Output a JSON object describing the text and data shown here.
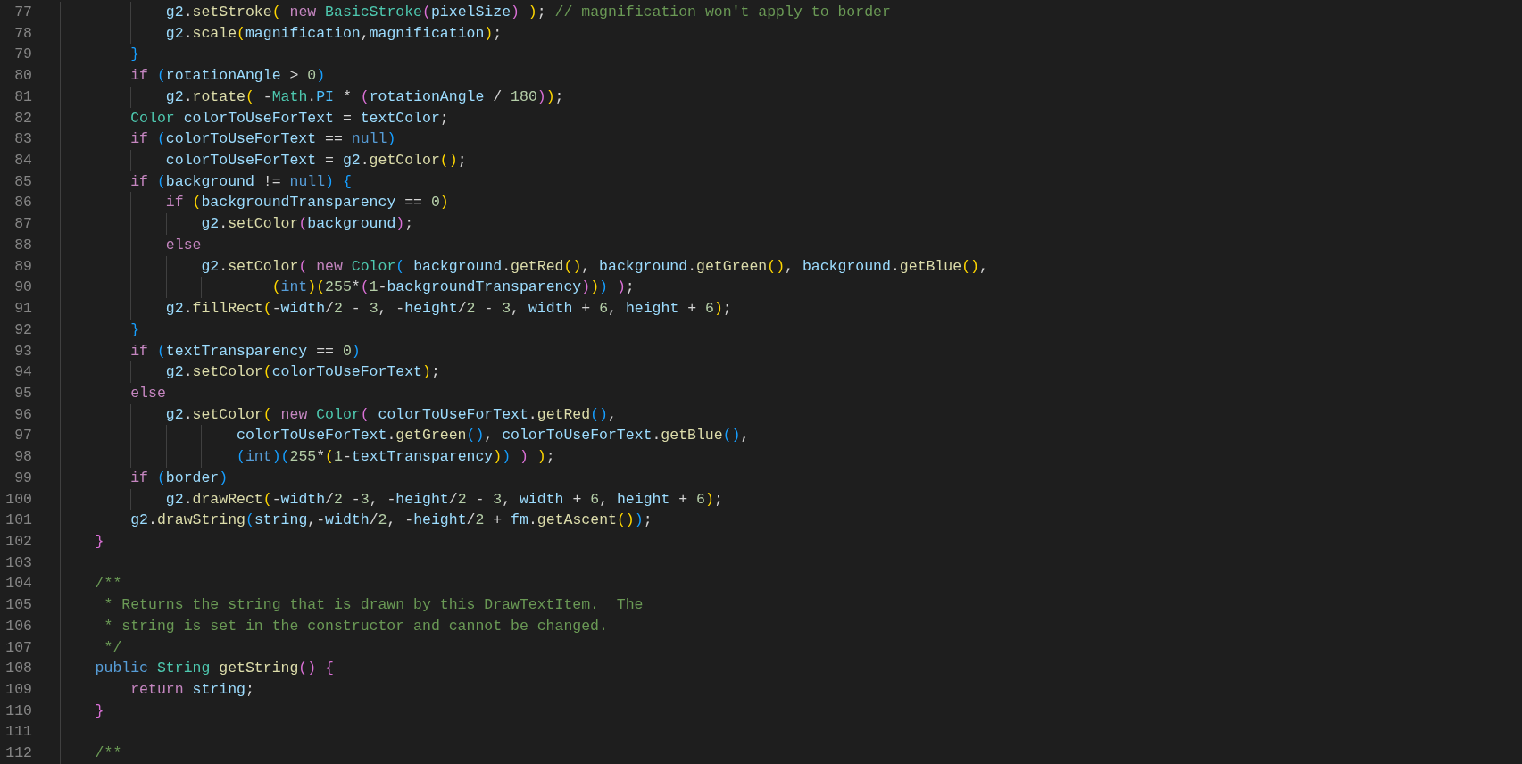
{
  "editor": {
    "lines": [
      {
        "number": "77",
        "tokens": [
          {
            "kind": "id",
            "text": "            g2"
          },
          {
            "kind": "p",
            "text": "."
          },
          {
            "kind": "fn",
            "text": "setStroke"
          },
          {
            "kind": "b1",
            "text": "( "
          },
          {
            "kind": "kw",
            "text": "new "
          },
          {
            "kind": "ty",
            "text": "BasicStroke"
          },
          {
            "kind": "b2",
            "text": "("
          },
          {
            "kind": "id",
            "text": "pixelSize"
          },
          {
            "kind": "b2",
            "text": ") "
          },
          {
            "kind": "b1",
            "text": ")"
          },
          {
            "kind": "p",
            "text": "; "
          },
          {
            "kind": "cm",
            "text": "// magnification won't apply to border"
          }
        ]
      },
      {
        "number": "78",
        "tokens": [
          {
            "kind": "id",
            "text": "            g2"
          },
          {
            "kind": "p",
            "text": "."
          },
          {
            "kind": "fn",
            "text": "scale"
          },
          {
            "kind": "b1",
            "text": "("
          },
          {
            "kind": "id",
            "text": "magnification"
          },
          {
            "kind": "p",
            "text": ","
          },
          {
            "kind": "id",
            "text": "magnification"
          },
          {
            "kind": "b1",
            "text": ")"
          },
          {
            "kind": "p",
            "text": ";"
          }
        ]
      },
      {
        "number": "79",
        "tokens": [
          {
            "kind": "b3",
            "text": "        }"
          }
        ]
      },
      {
        "number": "80",
        "tokens": [
          {
            "kind": "kw",
            "text": "        if "
          },
          {
            "kind": "b3",
            "text": "("
          },
          {
            "kind": "id",
            "text": "rotationAngle "
          },
          {
            "kind": "p",
            "text": "> "
          },
          {
            "kind": "num",
            "text": "0"
          },
          {
            "kind": "b3",
            "text": ")"
          }
        ]
      },
      {
        "number": "81",
        "tokens": [
          {
            "kind": "id",
            "text": "            g2"
          },
          {
            "kind": "p",
            "text": "."
          },
          {
            "kind": "fn",
            "text": "rotate"
          },
          {
            "kind": "b1",
            "text": "("
          },
          {
            "kind": "p",
            "text": " -"
          },
          {
            "kind": "ty",
            "text": "Math"
          },
          {
            "kind": "p",
            "text": "."
          },
          {
            "kind": "cn",
            "text": "PI"
          },
          {
            "kind": "p",
            "text": " * "
          },
          {
            "kind": "b2",
            "text": "("
          },
          {
            "kind": "id",
            "text": "rotationAngle "
          },
          {
            "kind": "p",
            "text": "/ "
          },
          {
            "kind": "num",
            "text": "180"
          },
          {
            "kind": "b2",
            "text": ")"
          },
          {
            "kind": "b1",
            "text": ")"
          },
          {
            "kind": "p",
            "text": ";"
          }
        ]
      },
      {
        "number": "82",
        "tokens": [
          {
            "kind": "ty",
            "text": "        Color "
          },
          {
            "kind": "id",
            "text": "colorToUseForText "
          },
          {
            "kind": "p",
            "text": "= "
          },
          {
            "kind": "id",
            "text": "textColor"
          },
          {
            "kind": "p",
            "text": ";"
          }
        ]
      },
      {
        "number": "83",
        "tokens": [
          {
            "kind": "kw",
            "text": "        if "
          },
          {
            "kind": "b3",
            "text": "("
          },
          {
            "kind": "id",
            "text": "colorToUseForText "
          },
          {
            "kind": "p",
            "text": "== "
          },
          {
            "kind": "st",
            "text": "null"
          },
          {
            "kind": "b3",
            "text": ")"
          }
        ]
      },
      {
        "number": "84",
        "tokens": [
          {
            "kind": "id",
            "text": "            colorToUseForText "
          },
          {
            "kind": "p",
            "text": "= "
          },
          {
            "kind": "id",
            "text": "g2"
          },
          {
            "kind": "p",
            "text": "."
          },
          {
            "kind": "fn",
            "text": "getColor"
          },
          {
            "kind": "b1",
            "text": "()"
          },
          {
            "kind": "p",
            "text": ";"
          }
        ]
      },
      {
        "number": "85",
        "tokens": [
          {
            "kind": "kw",
            "text": "        if "
          },
          {
            "kind": "b3",
            "text": "("
          },
          {
            "kind": "id",
            "text": "background "
          },
          {
            "kind": "p",
            "text": "!= "
          },
          {
            "kind": "st",
            "text": "null"
          },
          {
            "kind": "b3",
            "text": ") {"
          }
        ]
      },
      {
        "number": "86",
        "tokens": [
          {
            "kind": "kw",
            "text": "            if "
          },
          {
            "kind": "b1",
            "text": "("
          },
          {
            "kind": "id",
            "text": "backgroundTransparency "
          },
          {
            "kind": "p",
            "text": "== "
          },
          {
            "kind": "num",
            "text": "0"
          },
          {
            "kind": "b1",
            "text": ")"
          }
        ]
      },
      {
        "number": "87",
        "tokens": [
          {
            "kind": "id",
            "text": "                g2"
          },
          {
            "kind": "p",
            "text": "."
          },
          {
            "kind": "fn",
            "text": "setColor"
          },
          {
            "kind": "b2",
            "text": "("
          },
          {
            "kind": "id",
            "text": "background"
          },
          {
            "kind": "b2",
            "text": ")"
          },
          {
            "kind": "p",
            "text": ";"
          }
        ]
      },
      {
        "number": "88",
        "tokens": [
          {
            "kind": "kw",
            "text": "            else"
          }
        ]
      },
      {
        "number": "89",
        "tokens": [
          {
            "kind": "id",
            "text": "                g2"
          },
          {
            "kind": "p",
            "text": "."
          },
          {
            "kind": "fn",
            "text": "setColor"
          },
          {
            "kind": "b2",
            "text": "( "
          },
          {
            "kind": "kw",
            "text": "new "
          },
          {
            "kind": "ty",
            "text": "Color"
          },
          {
            "kind": "b3",
            "text": "( "
          },
          {
            "kind": "id",
            "text": "background"
          },
          {
            "kind": "p",
            "text": "."
          },
          {
            "kind": "fn",
            "text": "getRed"
          },
          {
            "kind": "b1",
            "text": "()"
          },
          {
            "kind": "p",
            "text": ", "
          },
          {
            "kind": "id",
            "text": "background"
          },
          {
            "kind": "p",
            "text": "."
          },
          {
            "kind": "fn",
            "text": "getGreen"
          },
          {
            "kind": "b1",
            "text": "()"
          },
          {
            "kind": "p",
            "text": ", "
          },
          {
            "kind": "id",
            "text": "background"
          },
          {
            "kind": "p",
            "text": "."
          },
          {
            "kind": "fn",
            "text": "getBlue"
          },
          {
            "kind": "b1",
            "text": "()"
          },
          {
            "kind": "p",
            "text": ","
          }
        ]
      },
      {
        "number": "90",
        "tokens": [
          {
            "kind": "b1",
            "text": "                        ("
          },
          {
            "kind": "st",
            "text": "int"
          },
          {
            "kind": "b1",
            "text": ")("
          },
          {
            "kind": "num",
            "text": "255"
          },
          {
            "kind": "p",
            "text": "*"
          },
          {
            "kind": "b2",
            "text": "("
          },
          {
            "kind": "num",
            "text": "1"
          },
          {
            "kind": "p",
            "text": "-"
          },
          {
            "kind": "id",
            "text": "backgroundTransparency"
          },
          {
            "kind": "b2",
            "text": ")"
          },
          {
            "kind": "b1",
            "text": ")"
          },
          {
            "kind": "b3",
            "text": ") "
          },
          {
            "kind": "b2",
            "text": ")"
          },
          {
            "kind": "p",
            "text": ";"
          }
        ]
      },
      {
        "number": "91",
        "tokens": [
          {
            "kind": "id",
            "text": "            g2"
          },
          {
            "kind": "p",
            "text": "."
          },
          {
            "kind": "fn",
            "text": "fillRect"
          },
          {
            "kind": "b1",
            "text": "("
          },
          {
            "kind": "p",
            "text": "-"
          },
          {
            "kind": "id",
            "text": "width"
          },
          {
            "kind": "p",
            "text": "/"
          },
          {
            "kind": "num",
            "text": "2"
          },
          {
            "kind": "p",
            "text": " - "
          },
          {
            "kind": "num",
            "text": "3"
          },
          {
            "kind": "p",
            "text": ", -"
          },
          {
            "kind": "id",
            "text": "height"
          },
          {
            "kind": "p",
            "text": "/"
          },
          {
            "kind": "num",
            "text": "2"
          },
          {
            "kind": "p",
            "text": " - "
          },
          {
            "kind": "num",
            "text": "3"
          },
          {
            "kind": "p",
            "text": ", "
          },
          {
            "kind": "id",
            "text": "width"
          },
          {
            "kind": "p",
            "text": " + "
          },
          {
            "kind": "num",
            "text": "6"
          },
          {
            "kind": "p",
            "text": ", "
          },
          {
            "kind": "id",
            "text": "height"
          },
          {
            "kind": "p",
            "text": " + "
          },
          {
            "kind": "num",
            "text": "6"
          },
          {
            "kind": "b1",
            "text": ")"
          },
          {
            "kind": "p",
            "text": ";"
          }
        ]
      },
      {
        "number": "92",
        "tokens": [
          {
            "kind": "b3",
            "text": "        }"
          }
        ]
      },
      {
        "number": "93",
        "tokens": [
          {
            "kind": "kw",
            "text": "        if "
          },
          {
            "kind": "b3",
            "text": "("
          },
          {
            "kind": "id",
            "text": "textTransparency "
          },
          {
            "kind": "p",
            "text": "== "
          },
          {
            "kind": "num",
            "text": "0"
          },
          {
            "kind": "b3",
            "text": ")"
          }
        ]
      },
      {
        "number": "94",
        "tokens": [
          {
            "kind": "id",
            "text": "            g2"
          },
          {
            "kind": "p",
            "text": "."
          },
          {
            "kind": "fn",
            "text": "setColor"
          },
          {
            "kind": "b1",
            "text": "("
          },
          {
            "kind": "id",
            "text": "colorToUseForText"
          },
          {
            "kind": "b1",
            "text": ")"
          },
          {
            "kind": "p",
            "text": ";"
          }
        ]
      },
      {
        "number": "95",
        "tokens": [
          {
            "kind": "kw",
            "text": "        else"
          }
        ]
      },
      {
        "number": "96",
        "tokens": [
          {
            "kind": "id",
            "text": "            g2"
          },
          {
            "kind": "p",
            "text": "."
          },
          {
            "kind": "fn",
            "text": "setColor"
          },
          {
            "kind": "b1",
            "text": "( "
          },
          {
            "kind": "kw",
            "text": "new "
          },
          {
            "kind": "ty",
            "text": "Color"
          },
          {
            "kind": "b2",
            "text": "( "
          },
          {
            "kind": "id",
            "text": "colorToUseForText"
          },
          {
            "kind": "p",
            "text": "."
          },
          {
            "kind": "fn",
            "text": "getRed"
          },
          {
            "kind": "b3",
            "text": "()"
          },
          {
            "kind": "p",
            "text": ","
          }
        ]
      },
      {
        "number": "97",
        "tokens": [
          {
            "kind": "id",
            "text": "                    colorToUseForText"
          },
          {
            "kind": "p",
            "text": "."
          },
          {
            "kind": "fn",
            "text": "getGreen"
          },
          {
            "kind": "b3",
            "text": "()"
          },
          {
            "kind": "p",
            "text": ", "
          },
          {
            "kind": "id",
            "text": "colorToUseForText"
          },
          {
            "kind": "p",
            "text": "."
          },
          {
            "kind": "fn",
            "text": "getBlue"
          },
          {
            "kind": "b3",
            "text": "()"
          },
          {
            "kind": "p",
            "text": ","
          }
        ]
      },
      {
        "number": "98",
        "tokens": [
          {
            "kind": "b3",
            "text": "                    ("
          },
          {
            "kind": "st",
            "text": "int"
          },
          {
            "kind": "b3",
            "text": ")("
          },
          {
            "kind": "num",
            "text": "255"
          },
          {
            "kind": "p",
            "text": "*"
          },
          {
            "kind": "b1",
            "text": "("
          },
          {
            "kind": "num",
            "text": "1"
          },
          {
            "kind": "p",
            "text": "-"
          },
          {
            "kind": "id",
            "text": "textTransparency"
          },
          {
            "kind": "b1",
            "text": ")"
          },
          {
            "kind": "b3",
            "text": ") "
          },
          {
            "kind": "b2",
            "text": ") "
          },
          {
            "kind": "b1",
            "text": ")"
          },
          {
            "kind": "p",
            "text": ";"
          }
        ]
      },
      {
        "number": "99",
        "tokens": [
          {
            "kind": "kw",
            "text": "        if "
          },
          {
            "kind": "b3",
            "text": "("
          },
          {
            "kind": "id",
            "text": "border"
          },
          {
            "kind": "b3",
            "text": ")"
          }
        ]
      },
      {
        "number": "100",
        "tokens": [
          {
            "kind": "id",
            "text": "            g2"
          },
          {
            "kind": "p",
            "text": "."
          },
          {
            "kind": "fn",
            "text": "drawRect"
          },
          {
            "kind": "b1",
            "text": "("
          },
          {
            "kind": "p",
            "text": "-"
          },
          {
            "kind": "id",
            "text": "width"
          },
          {
            "kind": "p",
            "text": "/"
          },
          {
            "kind": "num",
            "text": "2"
          },
          {
            "kind": "p",
            "text": " -"
          },
          {
            "kind": "num",
            "text": "3"
          },
          {
            "kind": "p",
            "text": ", -"
          },
          {
            "kind": "id",
            "text": "height"
          },
          {
            "kind": "p",
            "text": "/"
          },
          {
            "kind": "num",
            "text": "2"
          },
          {
            "kind": "p",
            "text": " - "
          },
          {
            "kind": "num",
            "text": "3"
          },
          {
            "kind": "p",
            "text": ", "
          },
          {
            "kind": "id",
            "text": "width"
          },
          {
            "kind": "p",
            "text": " + "
          },
          {
            "kind": "num",
            "text": "6"
          },
          {
            "kind": "p",
            "text": ", "
          },
          {
            "kind": "id",
            "text": "height"
          },
          {
            "kind": "p",
            "text": " + "
          },
          {
            "kind": "num",
            "text": "6"
          },
          {
            "kind": "b1",
            "text": ")"
          },
          {
            "kind": "p",
            "text": ";"
          }
        ]
      },
      {
        "number": "101",
        "tokens": [
          {
            "kind": "id",
            "text": "        g2"
          },
          {
            "kind": "p",
            "text": "."
          },
          {
            "kind": "fn",
            "text": "drawString"
          },
          {
            "kind": "b3",
            "text": "("
          },
          {
            "kind": "id",
            "text": "string"
          },
          {
            "kind": "p",
            "text": ",-"
          },
          {
            "kind": "id",
            "text": "width"
          },
          {
            "kind": "p",
            "text": "/"
          },
          {
            "kind": "num",
            "text": "2"
          },
          {
            "kind": "p",
            "text": ", -"
          },
          {
            "kind": "id",
            "text": "height"
          },
          {
            "kind": "p",
            "text": "/"
          },
          {
            "kind": "num",
            "text": "2"
          },
          {
            "kind": "p",
            "text": " + "
          },
          {
            "kind": "id",
            "text": "fm"
          },
          {
            "kind": "p",
            "text": "."
          },
          {
            "kind": "fn",
            "text": "getAscent"
          },
          {
            "kind": "b1",
            "text": "()"
          },
          {
            "kind": "b3",
            "text": ")"
          },
          {
            "kind": "p",
            "text": ";"
          }
        ]
      },
      {
        "number": "102",
        "tokens": [
          {
            "kind": "b2",
            "text": "    }"
          }
        ]
      },
      {
        "number": "103"
      },
      {
        "number": "104",
        "tokens": [
          {
            "kind": "cm",
            "text": "    /**"
          }
        ]
      },
      {
        "number": "105",
        "tokens": [
          {
            "kind": "cm",
            "text": "     * Returns the string that is drawn by this DrawTextItem.  The"
          }
        ]
      },
      {
        "number": "106",
        "tokens": [
          {
            "kind": "cm",
            "text": "     * string is set in the constructor and cannot be changed."
          }
        ]
      },
      {
        "number": "107",
        "tokens": [
          {
            "kind": "cm",
            "text": "     */"
          }
        ]
      },
      {
        "number": "108",
        "tokens": [
          {
            "kind": "st",
            "text": "    public "
          },
          {
            "kind": "ty",
            "text": "String "
          },
          {
            "kind": "fn",
            "text": "getString"
          },
          {
            "kind": "b2",
            "text": "() {"
          }
        ]
      },
      {
        "number": "109",
        "tokens": [
          {
            "kind": "kw",
            "text": "        return "
          },
          {
            "kind": "id",
            "text": "string"
          },
          {
            "kind": "p",
            "text": ";"
          }
        ]
      },
      {
        "number": "110",
        "tokens": [
          {
            "kind": "b2",
            "text": "    }"
          }
        ]
      },
      {
        "number": "111"
      },
      {
        "number": "112",
        "tokens": [
          {
            "kind": "cm",
            "text": "    /**"
          }
        ]
      }
    ]
  }
}
